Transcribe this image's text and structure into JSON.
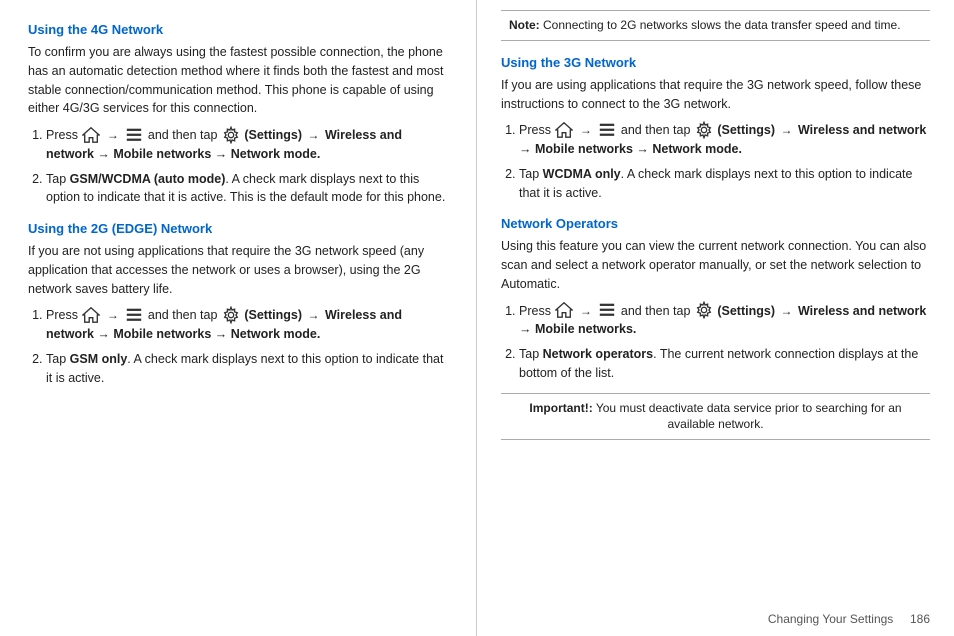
{
  "left": {
    "section1_title": "Using the 4G Network",
    "section1_p1": "To confirm you are always using the fastest possible connection, the phone has an automatic detection method where it finds both the fastest and most stable connection/communication method. This phone is capable of using either 4G/3G services for this connection.",
    "section1_steps": [
      {
        "num": "1.",
        "pre_icon1": "Press",
        "arrow1": "→",
        "pre_icon2": "",
        "arrow2": "→",
        "label_settings": "(Settings)",
        "arrow3": "→",
        "bold_text": "Wireless and network → Mobile networks  → Network mode."
      },
      {
        "num": "2.",
        "text_bold": "GSM/WCDMA (auto mode)",
        "text_rest": ". A check mark displays next to this option to indicate that it is active. This is the default mode for this phone."
      }
    ],
    "section2_title": "Using the 2G (EDGE) Network",
    "section2_p1": "If you are not using applications that require the 3G network speed (any application that accesses the network or uses a browser), using the 2G network saves battery life.",
    "section2_steps": [
      {
        "num": "1.",
        "pre_icon1": "Press",
        "arrow1": "→",
        "arrow2": "→",
        "label_settings": "(Settings)",
        "arrow3": "→",
        "bold_text": "Wireless and network → Mobile networks  → Network mode."
      },
      {
        "num": "2.",
        "text_bold": "GSM only",
        "text_rest": ". A check mark displays next to this option to indicate that it is active."
      }
    ]
  },
  "right": {
    "note_label": "Note:",
    "note_text": "Connecting to 2G networks slows the data transfer speed and time.",
    "section3_title": "Using the 3G Network",
    "section3_p1": "If you are using applications that require the 3G network speed, follow these instructions to connect to the 3G network.",
    "section3_steps": [
      {
        "num": "1.",
        "pre_icon1": "Press",
        "arrow1": "→",
        "and_then_tap": "and then tap",
        "arrow2": "→",
        "label_settings": "(Settings)",
        "arrow3": "→",
        "bold_text": "Wireless and network → Mobile networks → Network mode."
      },
      {
        "num": "2.",
        "text_bold": "WCDMA only",
        "text_rest": ". A check mark displays next to this option to indicate that it is active."
      }
    ],
    "section4_title": "Network Operators",
    "section4_p1": "Using this feature you can view the current network connection. You can also scan and select a network operator manually, or set the network selection to Automatic.",
    "section4_steps": [
      {
        "num": "1.",
        "pre_icon1": "Press",
        "arrow1": "→",
        "and_then_tap": "and then tap",
        "arrow2": "→",
        "label_settings": "(Settings)",
        "arrow3": "→",
        "bold_text": "Wireless and network → Mobile networks."
      },
      {
        "num": "2.",
        "text_bold": "Network operators",
        "text_rest": ". The current network connection displays at the bottom of the list."
      }
    ],
    "important_label": "Important!:",
    "important_text": "You must deactivate data service prior to searching for an available network.",
    "footer_text": "Changing Your Settings",
    "footer_page": "186"
  }
}
